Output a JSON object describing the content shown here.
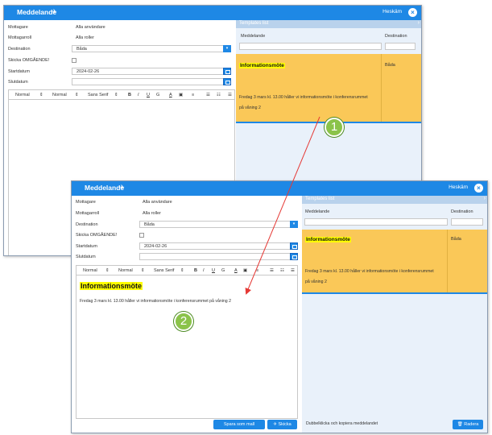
{
  "window1": {
    "title": "Meddelande",
    "plane_icon": "paper-plane-icon",
    "hemkam_label": "Heskäm",
    "close_icon": "close-icon",
    "form": {
      "mottagare_label": "Mottagare",
      "mottagare_value": "Alla användare",
      "mottagarroll_label": "Mottagarroll",
      "mottagarroll_value": "Alla roller",
      "destination_label": "Destination",
      "destination_value": "Båda",
      "skicka_label": "Skicka OMGÅENDE!",
      "startdatum_label": "Startdatum",
      "startdatum_value": "2024-02-26",
      "slutdatum_label": "Slutdatum",
      "slutdatum_value": ""
    },
    "toolbar": {
      "size": "Normal",
      "heading": "Normal",
      "font": "Sans Serif",
      "bold": "B",
      "italic": "I",
      "underline": "U",
      "link": "G",
      "color": "A",
      "image": "▣",
      "align": "≡",
      "ordered": "☰",
      "bullet": "☷",
      "list": "☰"
    },
    "templates": {
      "title": "Templates list",
      "chevron": "›",
      "col_meddelande": "Meddelande",
      "col_destination": "Destination",
      "row": {
        "title": "Informationsmöte",
        "body": "Fredag 3 mars kl. 13.00 håller vi informationsmöte i konferensrummet",
        "body2": "på våning 2",
        "destination": "Båda"
      }
    }
  },
  "window2": {
    "title": "Meddelande",
    "plane_icon": "paper-plane-icon",
    "hemkam_label": "Heskäm",
    "close_icon": "close-icon",
    "form": {
      "mottagare_label": "Mottagare",
      "mottagare_value": "Alla användare",
      "mottagarroll_label": "Mottagarroll",
      "mottagarroll_value": "Alla roller",
      "destination_label": "Destination",
      "destination_value": "Båda",
      "skicka_label": "Skicka OMGÅENDE!",
      "startdatum_label": "Startdatum",
      "startdatum_value": "2024-02-26",
      "slutdatum_label": "Slutdatum",
      "slutdatum_value": ""
    },
    "toolbar": {
      "size": "Normal",
      "heading": "Normal",
      "font": "Sans Serif",
      "bold": "B",
      "italic": "I",
      "underline": "U",
      "link": "G",
      "color": "A",
      "image": "▣",
      "align": "≡",
      "ordered": "☰",
      "bullet": "☷",
      "list": "☰"
    },
    "editor": {
      "heading": "Informationsmöte",
      "body": "Fredag 3 mars kl. 13.00 håller vi informationsmöte i konferensrummet på våning 2"
    },
    "buttons": {
      "save_mall": "Spara som mall",
      "send": "Skicka",
      "delete": "Radera"
    },
    "templates": {
      "title": "Templates list",
      "chevron": "›",
      "col_meddelande": "Meddelande",
      "col_destination": "Destination",
      "row": {
        "title": "Informationsmöte",
        "body": "Fredag 3 mars kl. 13.00 håller vi informationsmöte i konferensrummet",
        "body2": "på våning 2",
        "destination": "Båda"
      },
      "footer_hint": "Dubbelklicka och kopiera meddelandet"
    }
  },
  "annotations": {
    "step1": "1",
    "step2": "2",
    "badge_color": "#8bc34a",
    "arrow_color": "#e53935"
  }
}
